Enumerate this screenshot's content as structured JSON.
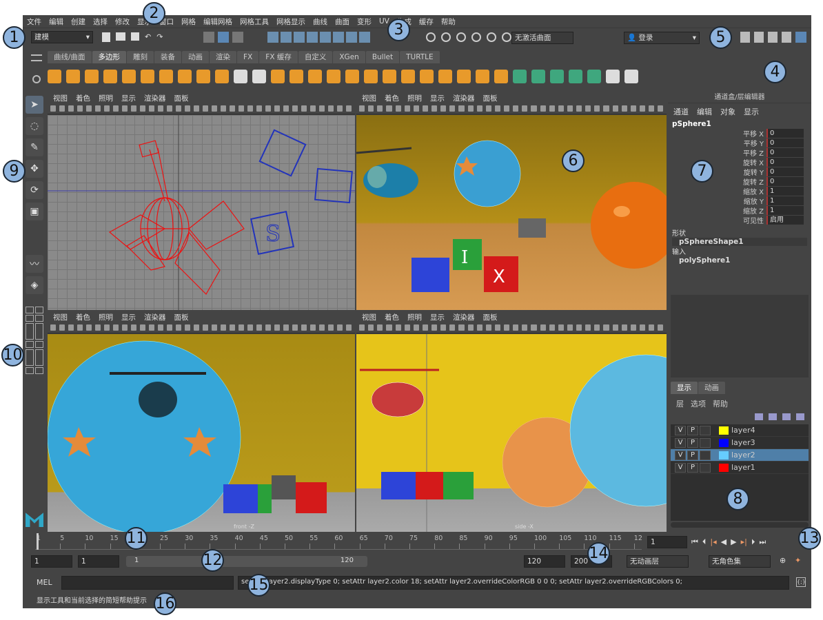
{
  "menus": [
    "文件",
    "编辑",
    "创建",
    "选择",
    "修改",
    "显示",
    "窗口",
    "网格",
    "编辑网格",
    "网格工具",
    "网格显示",
    "曲线",
    "曲面",
    "变形",
    "UV",
    "生成",
    "缓存",
    "帮助"
  ],
  "status": {
    "mode": "建模",
    "curve_field": "无激活曲面",
    "login": "登录"
  },
  "shelf_tabs": [
    "曲线/曲面",
    "多边形",
    "雕刻",
    "装备",
    "动画",
    "渲染",
    "FX",
    "FX 缓存",
    "自定义",
    "XGen",
    "Bullet",
    "TURTLE"
  ],
  "shelf_active": 1,
  "viewport_menu": [
    "视图",
    "着色",
    "照明",
    "显示",
    "渲染器",
    "面板"
  ],
  "viewports": {
    "bottom_left_label": "front -Z",
    "bottom_right_label": "side -X",
    "top_left_label": "Top"
  },
  "channel_box": {
    "title": "通道盒/层编辑器",
    "menu": [
      "通道",
      "编辑",
      "对象",
      "显示"
    ],
    "object": "pSphere1",
    "attributes": [
      {
        "name": "平移 X",
        "value": "0"
      },
      {
        "name": "平移 Y",
        "value": "0"
      },
      {
        "name": "平移 Z",
        "value": "0"
      },
      {
        "name": "旋转 X",
        "value": "0"
      },
      {
        "name": "旋转 Y",
        "value": "0"
      },
      {
        "name": "旋转 Z",
        "value": "0"
      },
      {
        "name": "缩放 X",
        "value": "1"
      },
      {
        "name": "缩放 Y",
        "value": "1"
      },
      {
        "name": "缩放 Z",
        "value": "1"
      },
      {
        "name": "可见性",
        "value": "启用"
      }
    ],
    "shape_header": "形状",
    "shape": "pSphereShape1",
    "input_header": "输入",
    "input": "polySphere1"
  },
  "layer_editor": {
    "tabs": [
      "显示",
      "动画"
    ],
    "menu": [
      "层",
      "选项",
      "帮助"
    ],
    "layers": [
      {
        "v": "V",
        "p": "P",
        "name": "layer4",
        "color": "#ffff00",
        "selected": false
      },
      {
        "v": "V",
        "p": "P",
        "name": "layer3",
        "color": "#0000ff",
        "selected": false
      },
      {
        "v": "V",
        "p": "P",
        "name": "layer2",
        "color": "#66ccff",
        "selected": true
      },
      {
        "v": "V",
        "p": "P",
        "name": "layer1",
        "color": "#ff0000",
        "selected": false
      }
    ]
  },
  "timeline": {
    "ticks": [
      "1",
      "5",
      "10",
      "15",
      "20",
      "25",
      "30",
      "35",
      "40",
      "45",
      "50",
      "55",
      "60",
      "65",
      "70",
      "75",
      "80",
      "85",
      "90",
      "95",
      "100",
      "105",
      "110",
      "115",
      "12"
    ],
    "current_frame": "1"
  },
  "range": {
    "start": "1",
    "inner_start": "1",
    "slider_start": "1",
    "slider_end": "120",
    "end": "120",
    "outer_end": "200",
    "anim_layer": "无动画层",
    "char_set": "无角色集"
  },
  "command": {
    "label": "MEL",
    "output": "setAttr layer2.displayType 0; setAttr layer2.color 18; setAttr layer2.overrideColorRGB 0 0 0; setAttr layer2.overrideRGBColors 0;"
  },
  "help_line": "显示工具和当前选择的简短帮助提示",
  "callouts": [
    "1",
    "2",
    "3",
    "4",
    "5",
    "6",
    "7",
    "8",
    "9",
    "10",
    "11",
    "12",
    "13",
    "14",
    "15",
    "16"
  ]
}
